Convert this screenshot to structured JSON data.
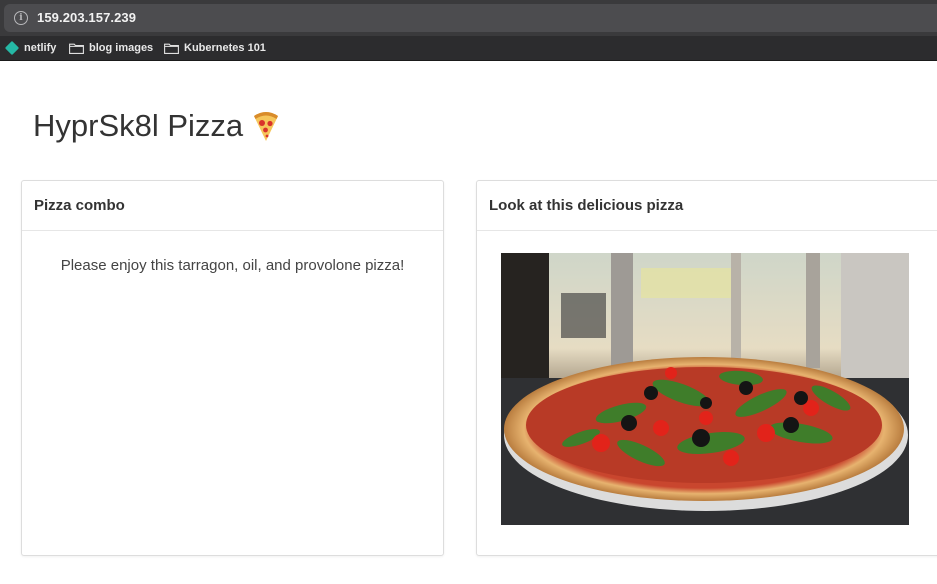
{
  "browser": {
    "url": "159.203.157.239",
    "bookmarks": [
      {
        "label": "netlify",
        "icon": "netlify-diamond-icon"
      },
      {
        "label": "blog images",
        "icon": "folder-icon"
      },
      {
        "label": "Kubernetes 101",
        "icon": "folder-icon"
      }
    ]
  },
  "page": {
    "title": "HyprSk8l Pizza",
    "title_icon": "pizza-icon"
  },
  "cards": {
    "combo": {
      "header": "Pizza combo",
      "text": "Please enjoy this tarragon, oil, and provolone pizza!"
    },
    "photo": {
      "header": "Look at this delicious pizza",
      "image_subject": "pizza-photo"
    }
  },
  "colors": {
    "netlify": "#25b8a5",
    "chrome_dark": "#3a3a3c",
    "text": "#333333"
  }
}
